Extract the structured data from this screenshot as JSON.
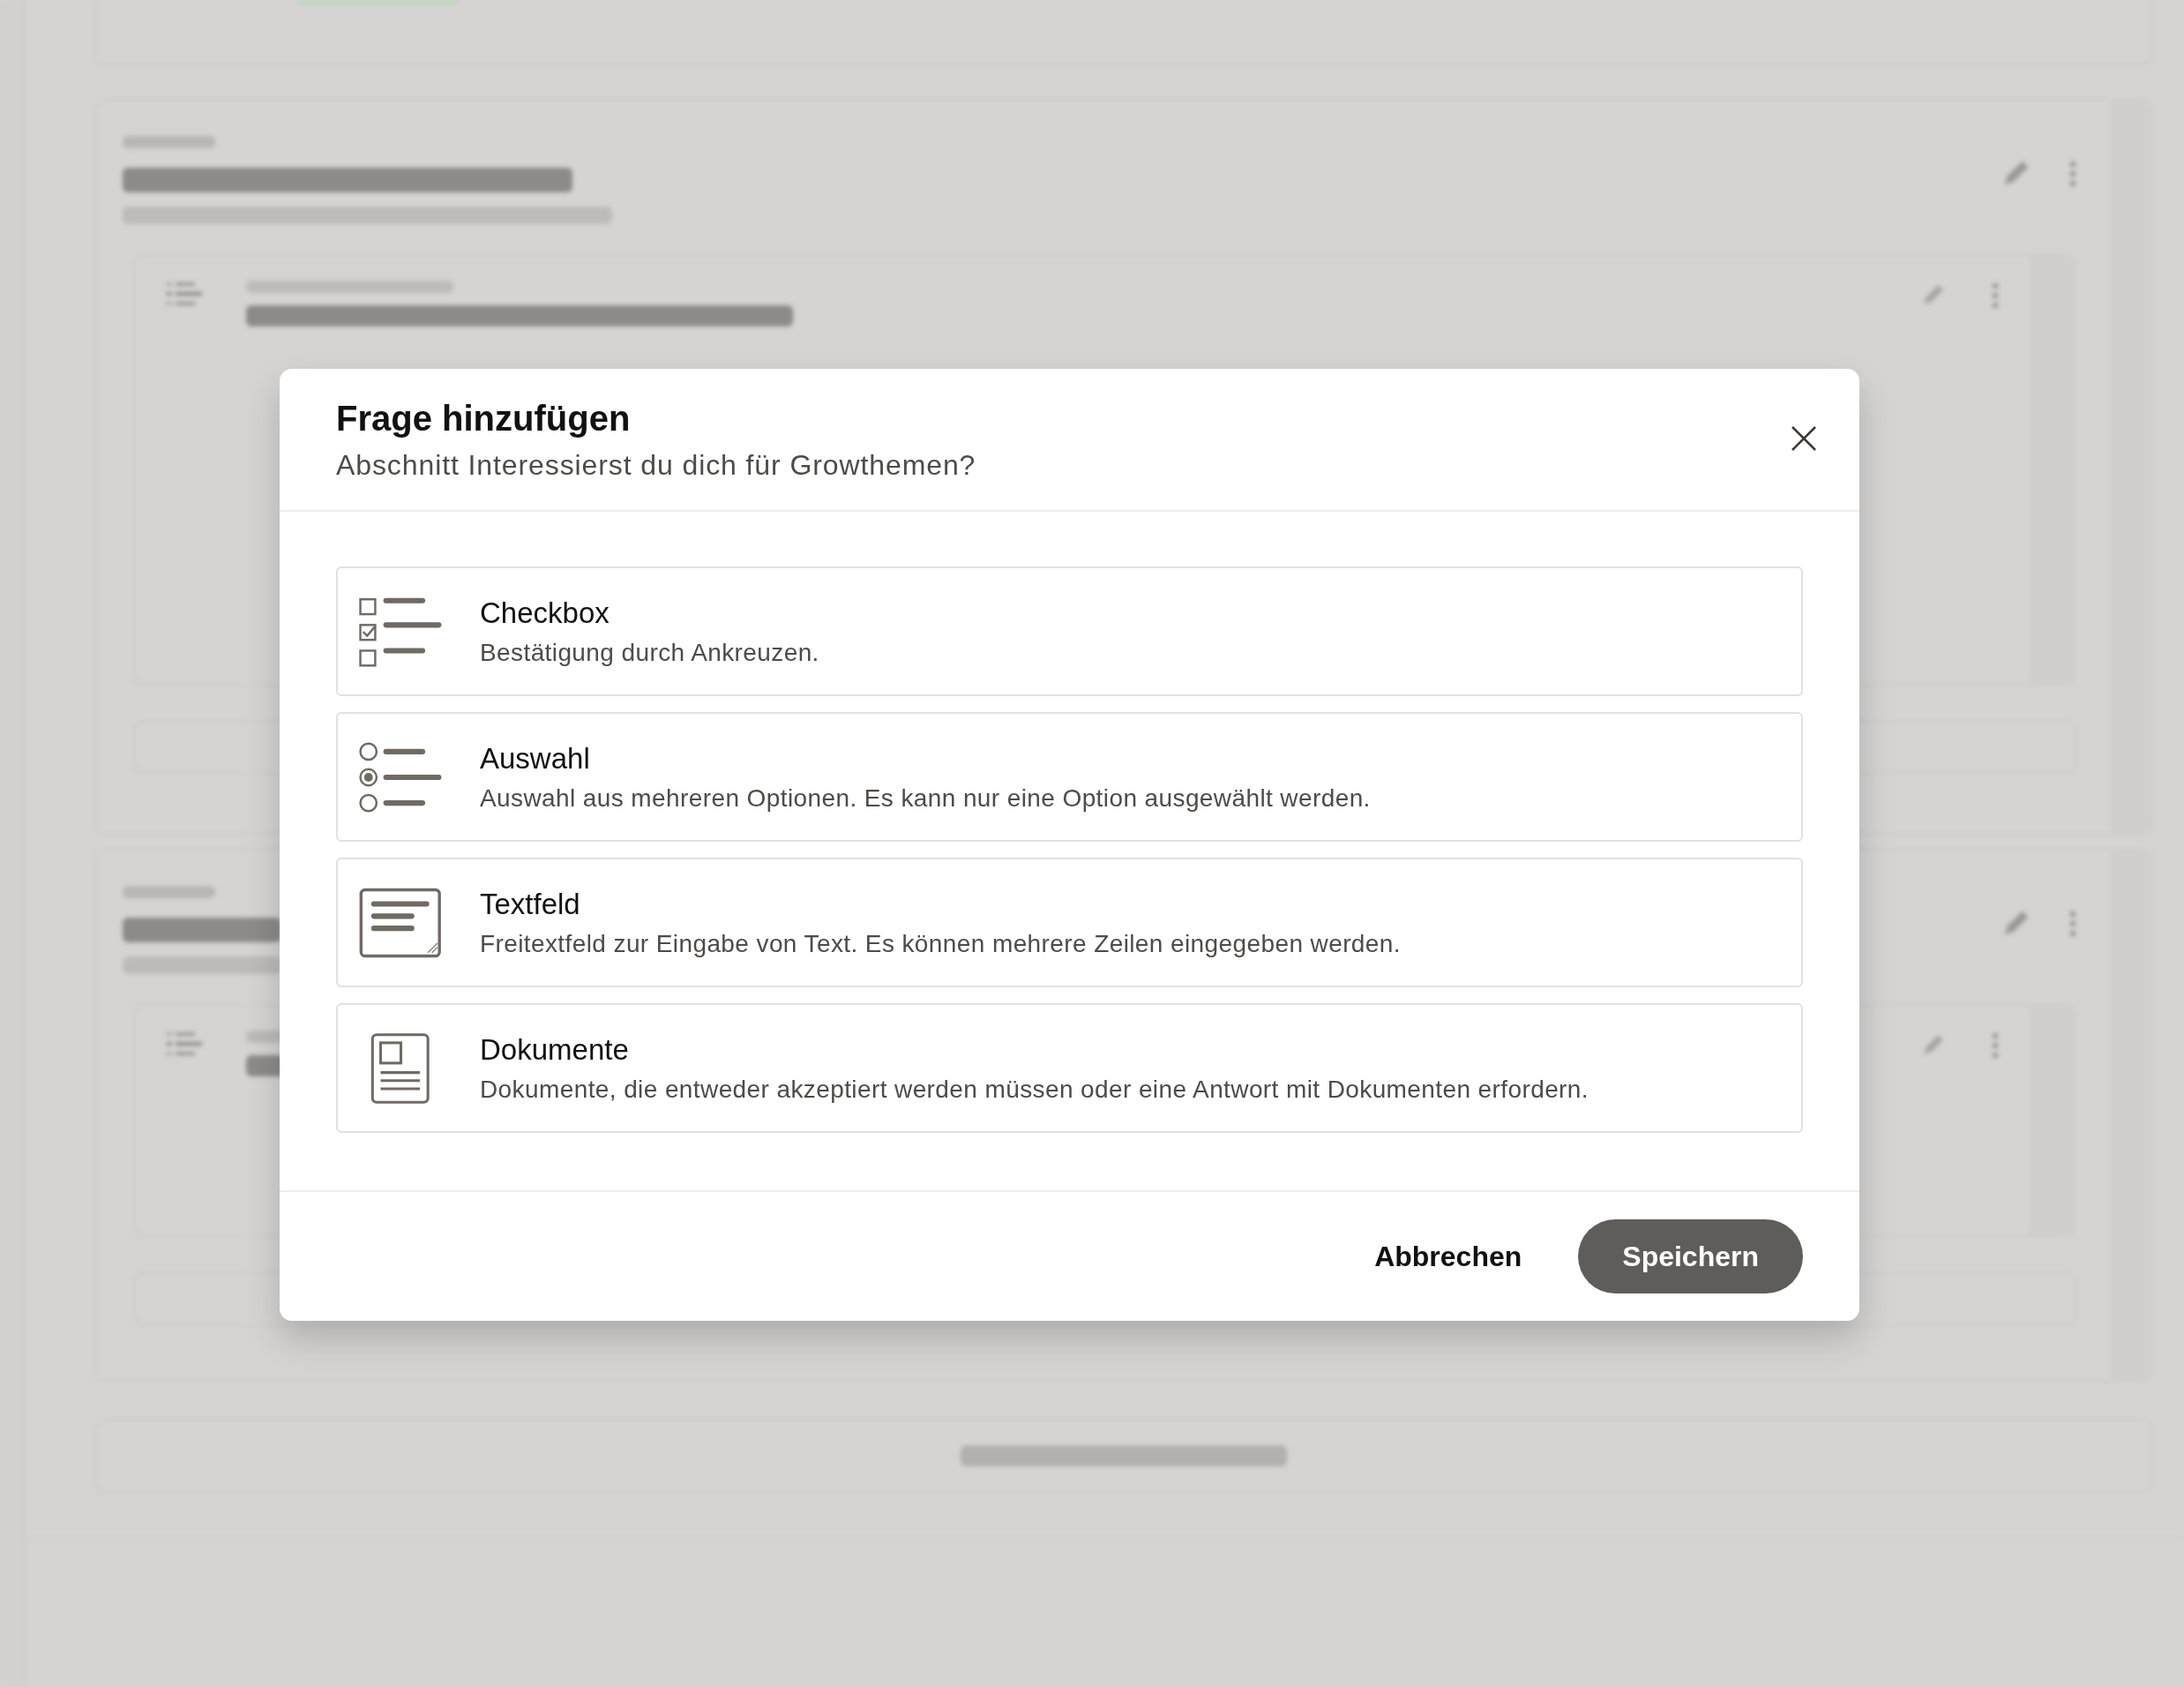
{
  "dialog": {
    "title": "Frage hinzufügen",
    "subtitle": "Abschnitt Interessierst du dich für Growthemen?",
    "options": [
      {
        "kind": "checkbox",
        "title": "Checkbox",
        "description": "Bestätigung durch Ankreuzen."
      },
      {
        "kind": "choice",
        "title": "Auswahl",
        "description": "Auswahl aus mehreren Optionen. Es kann nur eine Option ausgewählt werden."
      },
      {
        "kind": "textfield",
        "title": "Textfeld",
        "description": "Freitextfeld zur Eingabe von Text. Es können mehrere Zeilen eingegeben werden."
      },
      {
        "kind": "documents",
        "title": "Dokumente",
        "description": "Dokumente, die entweder akzeptiert werden müssen oder eine Antwort mit Dokumenten erfordern."
      }
    ],
    "buttons": [
      {
        "label": "Abbrechen",
        "kind": "secondary"
      },
      {
        "label": "Speichern",
        "kind": "primary"
      }
    ]
  }
}
